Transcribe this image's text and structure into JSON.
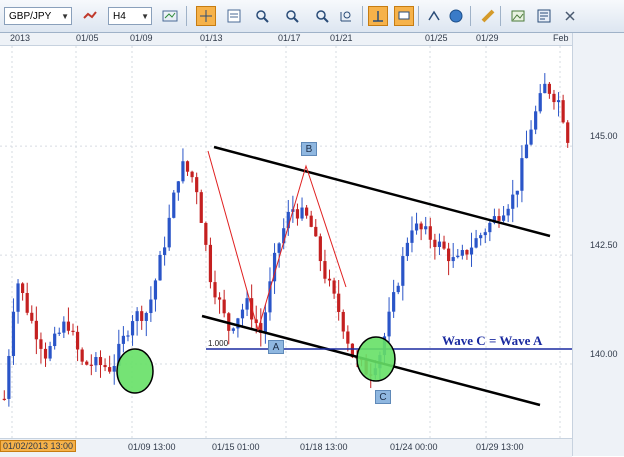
{
  "toolbar": {
    "symbol": "GBP/JPY",
    "timeframe": "H4",
    "buttons": [
      {
        "icon": "chart-type-icon"
      },
      {
        "icon": "crosshair-icon",
        "active": true
      },
      {
        "icon": "data-window-icon"
      },
      {
        "icon": "zoom-in-icon"
      },
      {
        "icon": "zoom-out-icon"
      },
      {
        "icon": "zoom-reset-icon"
      },
      {
        "icon": "draw-tool-icon",
        "active": true
      },
      {
        "icon": "comment-icon",
        "active": true
      },
      {
        "icon": "indicator-icon"
      },
      {
        "icon": "globe-icon"
      },
      {
        "icon": "ruler-icon"
      },
      {
        "icon": "image-icon"
      },
      {
        "icon": "save-icon"
      },
      {
        "icon": "settings-icon"
      }
    ]
  },
  "x_axis_top": [
    "2013",
    "01/05",
    "01/09",
    "01/13",
    "01/17",
    "01/21",
    "01/25",
    "01/29",
    "Feb"
  ],
  "x_axis_bottom": [
    "01/02/2013 13:00",
    "01/09 13:00",
    "01/15 01:00",
    "01/18 13:00",
    "01/24 00:00",
    "01/29 13:00"
  ],
  "annotations": {
    "point_a": "A",
    "point_b": "B",
    "point_c": "C",
    "fib_level": "1.000",
    "wave_text": "Wave C = Wave A"
  },
  "chart_data": {
    "type": "candlestick",
    "symbol": "GBP/JPY",
    "timeframe": "H4",
    "y_ticks": [
      "145.00",
      "142.50",
      "140.00"
    ],
    "ylim": [
      138.3,
      147.3
    ],
    "start": 139.2,
    "trend_path": [
      [
        0,
        139.2
      ],
      [
        8,
        142.0
      ],
      [
        18,
        141.0
      ],
      [
        28,
        140.2
      ],
      [
        42,
        141.0
      ],
      [
        52,
        140.0
      ],
      [
        62,
        140.0
      ],
      [
        72,
        139.9
      ],
      [
        86,
        141.1
      ],
      [
        96,
        141.2
      ],
      [
        108,
        142.9
      ],
      [
        118,
        144.6
      ],
      [
        128,
        144.2
      ],
      [
        138,
        142.0
      ],
      [
        150,
        140.8
      ],
      [
        162,
        141.4
      ],
      [
        172,
        140.7
      ],
      [
        182,
        142.6
      ],
      [
        192,
        143.6
      ],
      [
        204,
        143.3
      ],
      [
        214,
        142.1
      ],
      [
        224,
        141.2
      ],
      [
        234,
        140.1
      ],
      [
        244,
        139.8
      ],
      [
        252,
        140.3
      ],
      [
        262,
        141.7
      ],
      [
        272,
        143.2
      ],
      [
        282,
        143.0
      ],
      [
        292,
        142.7
      ],
      [
        302,
        142.3
      ],
      [
        312,
        142.7
      ],
      [
        322,
        143.1
      ],
      [
        332,
        143.5
      ],
      [
        342,
        143.9
      ],
      [
        352,
        145.4
      ],
      [
        362,
        146.4
      ],
      [
        372,
        146.0
      ],
      [
        377,
        145.2
      ]
    ],
    "candle_count": 124,
    "wave_c_equals_wave_a_level": 140.1
  }
}
